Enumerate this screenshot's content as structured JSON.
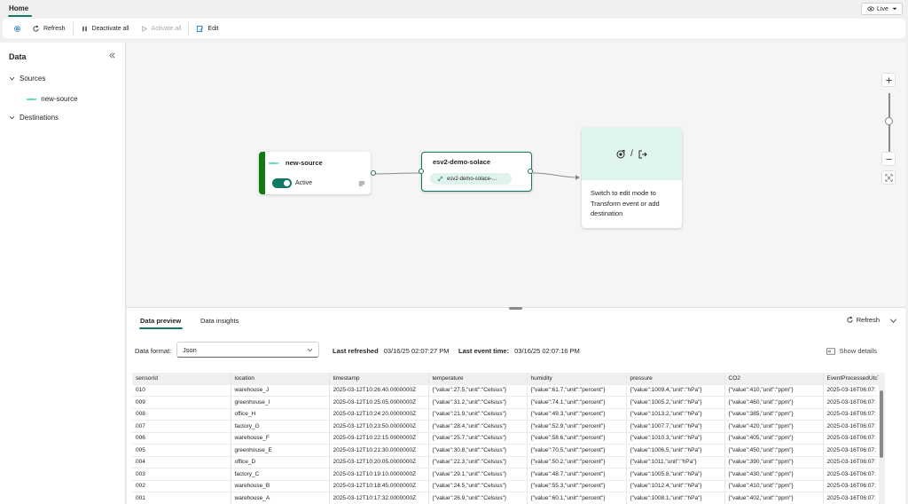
{
  "tabs": {
    "home": "Home"
  },
  "live": {
    "label": "Live"
  },
  "toolbar": {
    "refresh": "Refresh",
    "deactivate_all": "Deactivate all",
    "activate_all": "Activate all",
    "edit": "Edit"
  },
  "left_panel": {
    "title": "Data",
    "sources_label": "Sources",
    "source_item": "new-source",
    "destinations_label": "Destinations"
  },
  "canvas": {
    "source_node": {
      "logo": "solace",
      "title": "new-source",
      "status": "Active"
    },
    "stream_node": {
      "title": "esv2-demo-solace",
      "pill": "esv2-demo-solace-..."
    },
    "destination_node": {
      "separator": "/",
      "text": "Switch to edit mode to Transform event or add destination"
    }
  },
  "bottom": {
    "tabs": [
      "Data preview",
      "Data insights"
    ],
    "refresh": "Refresh",
    "data_format_label": "Data format:",
    "data_format_value": "Json",
    "last_refreshed_label": "Last refreshed",
    "last_refreshed_value": "03/16/25 02:07:27 PM",
    "last_event_label": "Last event time:",
    "last_event_value": "03/16/25 02:07:16 PM",
    "show_details": "Show details",
    "table": {
      "columns": [
        "sensorId",
        "location",
        "timestamp",
        "temperature",
        "humidity",
        "pressure",
        "CO2",
        "EventProcessedUtcTime"
      ],
      "rows": [
        [
          "010",
          "warehouse_J",
          "2025-03-12T10:26:40.0000000Z",
          "{\"value\":27.5,\"unit\":\"Celsius\"}",
          "{\"value\":61.7,\"unit\":\"percent\"}",
          "{\"value\":1009.4,\"unit\":\"hPa\"}",
          "{\"value\":410,\"unit\":\"ppm\"}",
          "2025-03-16T06:07:"
        ],
        [
          "009",
          "greenhouse_I",
          "2025-03-12T10:25:05.0000000Z",
          "{\"value\":31.2,\"unit\":\"Celsius\"}",
          "{\"value\":74.1,\"unit\":\"percent\"}",
          "{\"value\":1005.2,\"unit\":\"hPa\"}",
          "{\"value\":460,\"unit\":\"ppm\"}",
          "2025-03-16T06:07:"
        ],
        [
          "008",
          "office_H",
          "2025-03-12T10:24:20.0000000Z",
          "{\"value\":21.9,\"unit\":\"Celsius\"}",
          "{\"value\":49.3,\"unit\":\"percent\"}",
          "{\"value\":1013.2,\"unit\":\"hPa\"}",
          "{\"value\":385,\"unit\":\"ppm\"}",
          "2025-03-16T06:07:"
        ],
        [
          "007",
          "factory_G",
          "2025-03-12T10:23:50.0000000Z",
          "{\"value\":28.4,\"unit\":\"Celsius\"}",
          "{\"value\":52.9,\"unit\":\"percent\"}",
          "{\"value\":1007.7,\"unit\":\"hPa\"}",
          "{\"value\":420,\"unit\":\"ppm\"}",
          "2025-03-16T06:07:"
        ],
        [
          "006",
          "warehouse_F",
          "2025-03-12T10:22:15.0000000Z",
          "{\"value\":25.7,\"unit\":\"Celsius\"}",
          "{\"value\":58.6,\"unit\":\"percent\"}",
          "{\"value\":1010.3,\"unit\":\"hPa\"}",
          "{\"value\":405,\"unit\":\"ppm\"}",
          "2025-03-16T06:07:"
        ],
        [
          "005",
          "greenhouse_E",
          "2025-03-12T10:21:30.0000000Z",
          "{\"value\":30.8,\"unit\":\"Celsius\"}",
          "{\"value\":70.5,\"unit\":\"percent\"}",
          "{\"value\":1006.5,\"unit\":\"hPa\"}",
          "{\"value\":450,\"unit\":\"ppm\"}",
          "2025-03-16T06:07:"
        ],
        [
          "004",
          "office_D",
          "2025-03-12T10:20:05.0000000Z",
          "{\"value\":22.3,\"unit\":\"Celsius\"}",
          "{\"value\":50.2,\"unit\":\"percent\"}",
          "{\"value\":1011,\"unit\":\"hPa\"}",
          "{\"value\":390,\"unit\":\"ppm\"}",
          "2025-03-16T06:07:"
        ],
        [
          "003",
          "factory_C",
          "2025-03-12T10:19:10.0000000Z",
          "{\"value\":29.1,\"unit\":\"Celsius\"}",
          "{\"value\":48.7,\"unit\":\"percent\"}",
          "{\"value\":1005.8,\"unit\":\"hPa\"}",
          "{\"value\":430,\"unit\":\"ppm\"}",
          "2025-03-16T06:07:"
        ],
        [
          "002",
          "warehouse_B",
          "2025-03-12T10:18:45.0000000Z",
          "{\"value\":24.5,\"unit\":\"Celsius\"}",
          "{\"value\":55.3,\"unit\":\"percent\"}",
          "{\"value\":1012.4,\"unit\":\"hPa\"}",
          "{\"value\":410,\"unit\":\"ppm\"}",
          "2025-03-16T06:07:"
        ],
        [
          "001",
          "warehouse_A",
          "2025-03-12T10:17:32.0000000Z",
          "{\"value\":26.9,\"unit\":\"Celsius\"}",
          "{\"value\":60.1,\"unit\":\"percent\"}",
          "{\"value\":1008.1,\"unit\":\"hPa\"}",
          "{\"value\":402,\"unit\":\"ppm\"}",
          "2025-03-16T06:07:"
        ]
      ]
    }
  },
  "colors": {
    "accent": "#117865",
    "source_bar": "#107c10",
    "dest_bg": "#e0f5ec"
  }
}
